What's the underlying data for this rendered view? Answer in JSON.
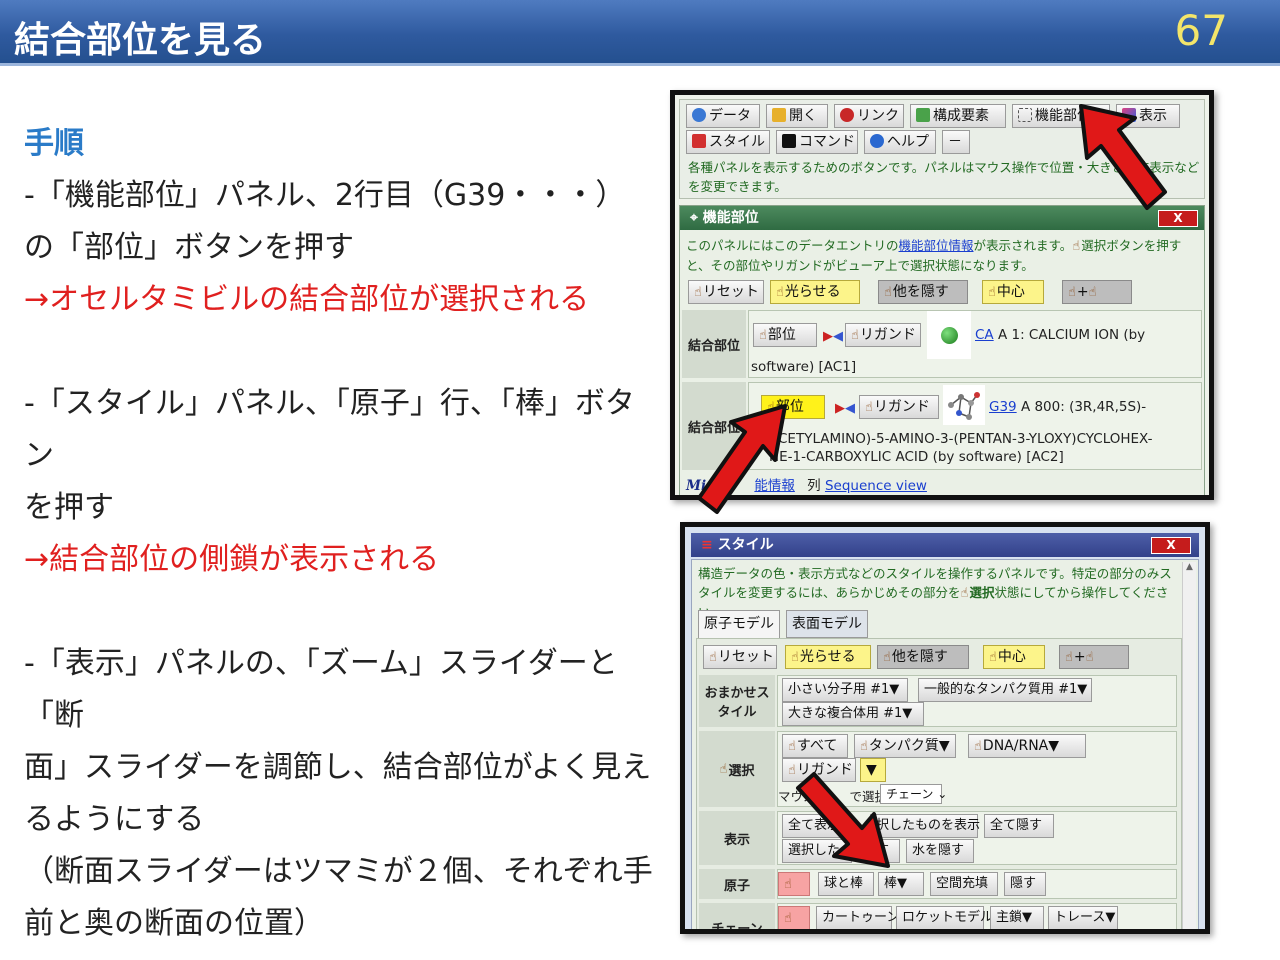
{
  "slide": {
    "title": "結合部位を見る",
    "number": "67"
  },
  "instructions": {
    "heading": "手順",
    "step1_line1": "-「機能部位」パネル、2行目（G39・・・）",
    "step1_line2": "の「部位」ボタンを押す",
    "step1_result": "→オセルタミビルの結合部位が選択される",
    "step2_line1": "-「スタイル」パネル、「原子」行、「棒」ボタン",
    "step2_line2": "を押す",
    "step2_result": "→結合部位の側鎖が表示される",
    "step3_line1": "-「表示」パネルの、「ズーム」スライダーと「断",
    "step3_line2": "面」スライダーを調節し、結合部位がよく見え",
    "step3_line3": "るようにする",
    "step3_line4": "（断面スライダーはツマミが２個、それぞれ手",
    "step3_line5": "前と奥の断面の位置）"
  },
  "panel_buttons": {
    "row1": [
      "データ",
      "開く",
      "リンク",
      "構成要素",
      "機能部位",
      "表示"
    ],
    "row2": [
      "スタイル",
      "コマンド",
      "ヘルプ",
      "－"
    ],
    "note": "各種パネルを表示するためのボタンです。パネルはマウス操作で位置・大きさ・非表示などを変更できます。"
  },
  "func_panel": {
    "title": "機能部位",
    "close": "X",
    "note_a": "このパネルにはこのデータエントリの",
    "note_link": "機能部位情報",
    "note_b": "が表示されます。",
    "note_c": "選択ボタンを押すと、その部位やリガンドがビューア上で選択状態になります。",
    "toolbar": [
      "リセット",
      "光らせる",
      "他を隠す",
      "中心",
      "+"
    ],
    "rows": [
      {
        "label": "結合部位",
        "site_btn": "部位",
        "ligand_btn": "リガンド",
        "id": "CA",
        "desc1": "A 1: CALCIUM ION (by",
        "desc2": "software) [AC1]"
      },
      {
        "label": "結合部位",
        "site_btn": "部位",
        "ligand_btn": "リガンド",
        "id": "G39",
        "desc1": "A 800: (3R,4R,5S)-",
        "desc2": "ACETYLAMINO)-5-AMINO-3-(PENTAN-3-YLOXY)CYCLOHEX-",
        "desc3": "NE-1-CARBOXYLIC ACID (by software) [AC2]"
      }
    ],
    "footer_brand": "Mi",
    "footer_link": "能情報",
    "footer_col": "列",
    "footer_seq": "Sequence view"
  },
  "style_panel": {
    "title": "スタイル",
    "close": "X",
    "note_a": "構造データの色・表示方式などのスタイルを操作するパネルです。特定の部分のみスタイルを変更するには、あらかじめその部分を",
    "note_b": "選択",
    "note_c": "状態にしてから操作してください。",
    "tabs": [
      "原子モデル",
      "表面モデル"
    ],
    "toolbar": [
      "リセット",
      "光らせる",
      "他を隠す",
      "中心",
      "+"
    ],
    "omakase_label": "おまかせスタイル",
    "omakase": [
      "小さい分子用 #1▼",
      "一般的なタンパク質用 #1▼",
      "大きな複合体用 #1▼"
    ],
    "select_label": "選択",
    "select": [
      "すべて",
      "タンパク質▼",
      "DNA/RNA▼",
      "リガンド",
      "▼"
    ],
    "mouse_prefix": "マウス",
    "mouse_mid": "で選択",
    "chain_option": "チェーン",
    "display_label": "表示",
    "display": [
      "全て表示",
      "択したものを表示",
      "全て隠す",
      "選択した",
      "す",
      "水を隠す"
    ],
    "atom_label": "原子",
    "atom": [
      "球と棒",
      "棒▼",
      "空間充填",
      "隠す"
    ],
    "chain_label": "チェーン",
    "chain": [
      "カートゥーン",
      "ロケットモデル",
      "主鎖▼",
      "トレース▼"
    ]
  }
}
